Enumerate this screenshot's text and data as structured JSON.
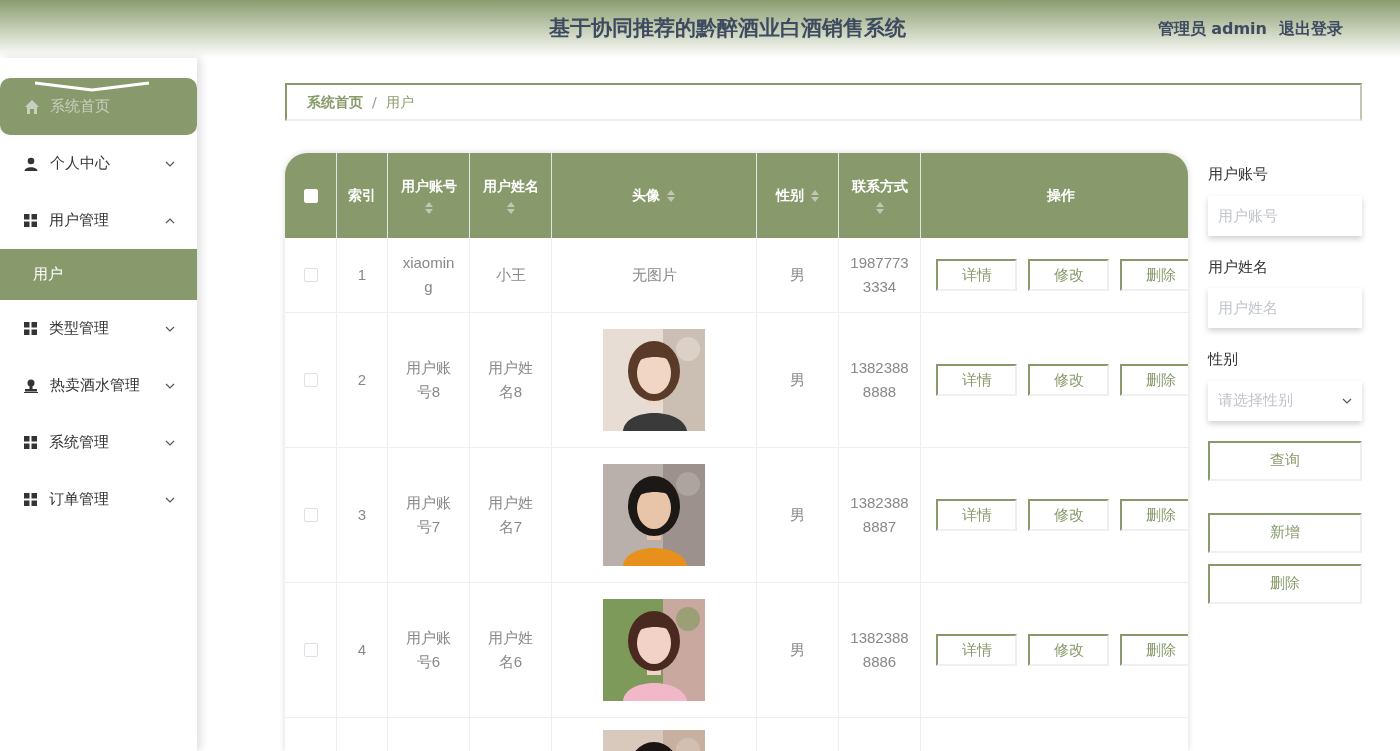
{
  "header": {
    "title": "基于协同推荐的黔醉酒业白酒销售系统",
    "user": "管理员 admin",
    "logout": "退出登录"
  },
  "sidebar": {
    "items": [
      {
        "label": "系统首页",
        "kind": "link",
        "selected": true
      },
      {
        "label": "个人中心",
        "kind": "menu",
        "selected": false,
        "expanded": false
      },
      {
        "label": "用户管理",
        "kind": "menu",
        "selected": false,
        "expanded": true,
        "children": [
          {
            "label": "用户",
            "selected": true
          }
        ]
      },
      {
        "label": "类型管理",
        "kind": "menu",
        "selected": false,
        "expanded": false
      },
      {
        "label": "热卖酒水管理",
        "kind": "menu",
        "selected": false,
        "expanded": false
      },
      {
        "label": "系统管理",
        "kind": "menu",
        "selected": false,
        "expanded": false
      },
      {
        "label": "订单管理",
        "kind": "menu",
        "selected": false,
        "expanded": false
      }
    ]
  },
  "breadcrumb": [
    {
      "label": "系统首页",
      "selected": false
    },
    {
      "separator": "/",
      "label": "用户",
      "selected": true
    }
  ],
  "table": {
    "select_all_checked": false,
    "columns": [
      {
        "label": "索引",
        "sortable": false
      },
      {
        "label": "用户账号",
        "sortable": true
      },
      {
        "label": "用户姓名",
        "sortable": true
      },
      {
        "label": "头像",
        "sortable": true
      },
      {
        "label": "性别",
        "sortable": true
      },
      {
        "label": "联系方式",
        "sortable": true
      },
      {
        "label": "操作",
        "sortable": false
      }
    ],
    "rows": [
      {
        "checked": false,
        "index": "1",
        "account": "xiaoming",
        "name": "小王",
        "avatar": {
          "kind": "none",
          "text": "无图片"
        },
        "gender": "男",
        "phone": "19877733334",
        "actions": [
          "详情",
          "修改",
          "删除"
        ]
      },
      {
        "checked": false,
        "index": "2",
        "account": "用户账号8",
        "name": "用户姓名8",
        "avatar": {
          "kind": "picture"
        },
        "gender": "男",
        "phone": "13823888888",
        "actions": [
          "详情",
          "修改",
          "删除"
        ]
      },
      {
        "checked": false,
        "index": "3",
        "account": "用户账号7",
        "name": "用户姓名7",
        "avatar": {
          "kind": "picture"
        },
        "gender": "男",
        "phone": "13823888887",
        "actions": [
          "详情",
          "修改",
          "删除"
        ]
      },
      {
        "checked": false,
        "index": "4",
        "account": "用户账号6",
        "name": "用户姓名6",
        "avatar": {
          "kind": "picture"
        },
        "gender": "男",
        "phone": "13823888886",
        "actions": [
          "详情",
          "修改",
          "删除"
        ]
      },
      {
        "avatar": {
          "kind": "picture"
        }
      }
    ]
  },
  "search": {
    "fields": [
      {
        "label": "用户账号",
        "kind": "input",
        "placeholder": "用户账号"
      },
      {
        "label": "用户姓名",
        "kind": "input",
        "placeholder": "用户姓名"
      },
      {
        "label": "性别",
        "kind": "select",
        "placeholder": "请选择性别"
      }
    ],
    "query_button": "查询",
    "buttons": [
      "新增",
      "删除"
    ]
  }
}
